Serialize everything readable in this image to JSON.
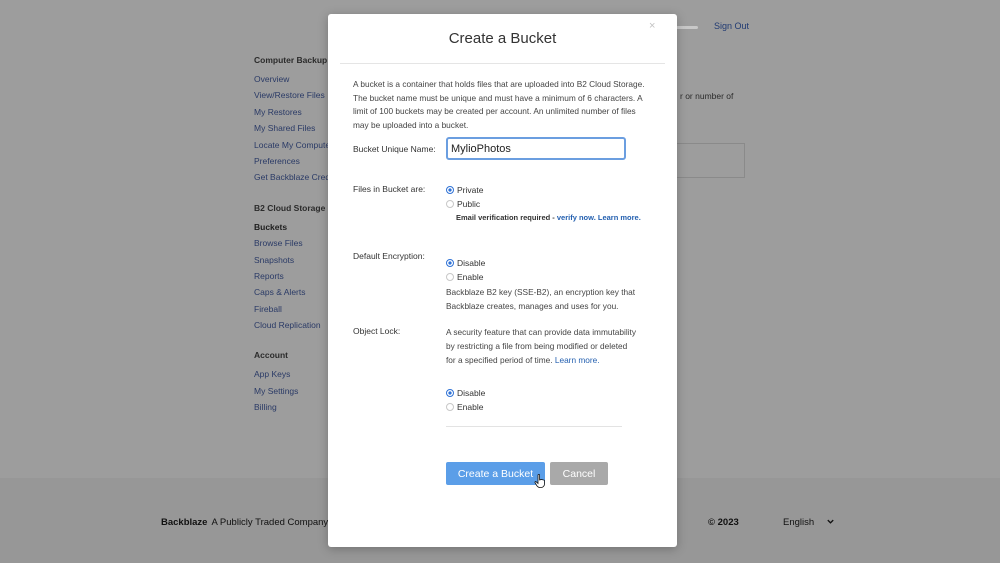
{
  "header": {
    "sign_out": "Sign Out"
  },
  "sidebar": {
    "groups": [
      {
        "heading": "Computer Backup",
        "items": [
          "Overview",
          "View/Restore Files",
          "My Restores",
          "My Shared Files",
          "Locate My Computer",
          "Preferences",
          "Get Backblaze Credit"
        ]
      },
      {
        "heading": "B2 Cloud Storage",
        "items": [
          "Buckets",
          "Browse Files",
          "Snapshots",
          "Reports",
          "Caps & Alerts",
          "Fireball",
          "Cloud Replication"
        ]
      },
      {
        "heading": "Account",
        "items": [
          "App Keys",
          "My Settings",
          "Billing"
        ]
      }
    ],
    "active_item": "Buckets"
  },
  "background": {
    "partial_text": "r or number of"
  },
  "footer": {
    "brand": "Backblaze",
    "tagline": "A Publicly Traded Company",
    "copyright": "© 2023",
    "language": "English"
  },
  "modal": {
    "close": "×",
    "title": "Create a Bucket",
    "intro": "A bucket is a container that holds files that are uploaded into B2 Cloud Storage. The bucket name must be unique and must have a minimum of 6 characters. A limit of 100 buckets may be created per account. An unlimited number of files may be uploaded into a bucket.",
    "bucket_name_label": "Bucket Unique Name:",
    "bucket_name_value": "MylioPhotos",
    "files_label": "Files in Bucket are:",
    "files_options": [
      "Private",
      "Public"
    ],
    "files_selected": "Private",
    "verify_note": "Email verification required - ",
    "verify_link": "verify now.",
    "learn_more": "Learn more.",
    "encryption_label": "Default Encryption:",
    "encryption_options": [
      "Disable",
      "Enable"
    ],
    "encryption_selected": "Disable",
    "encryption_desc": "Backblaze B2 key (SSE-B2), an encryption key that Backblaze creates, manages and uses for you.",
    "lock_label": "Object Lock:",
    "lock_desc": "A security feature that can provide data immutability by restricting a file from being modified or deleted for a specified period of time.",
    "lock_learn_more": "Learn more.",
    "lock_options": [
      "Disable",
      "Enable"
    ],
    "lock_selected": "Disable",
    "create_button": "Create a Bucket",
    "cancel_button": "Cancel"
  },
  "colors": {
    "primary": "#5b9ee8",
    "link": "#2460b0",
    "radio_on": "#2f72d6"
  }
}
